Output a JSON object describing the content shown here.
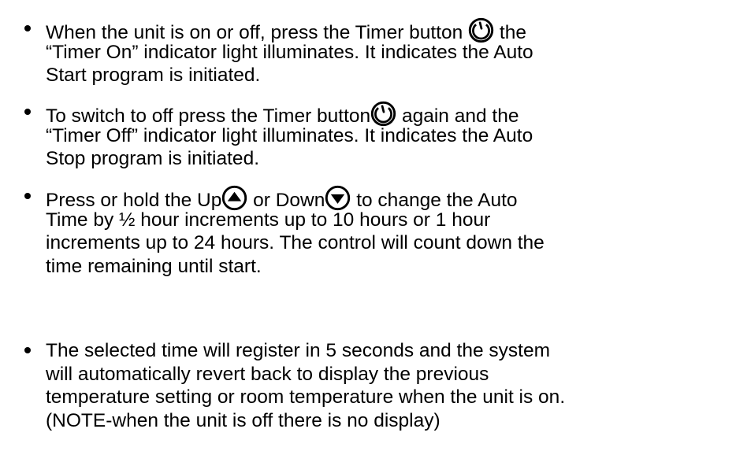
{
  "bullets": [
    {
      "lines": [
        {
          "pre": "When the unit is on or off, press the Timer button ",
          "icon": "timer-icon",
          "post": " the"
        },
        {
          "text": "“Timer On” indicator light illuminates.  It indicates the Auto"
        },
        {
          "text": "Start program is initiated."
        }
      ]
    },
    {
      "lines": [
        {
          "pre": "To switch to off press the Timer button",
          "icon": "timer-icon",
          "post": "  again and the"
        },
        {
          "text": "“Timer Off” indicator light illuminates.  It indicates the Auto"
        },
        {
          "text": "Stop program is initiated."
        }
      ]
    },
    {
      "lines": [
        {
          "pre": "Press or hold the Up",
          "icon1": "up-arrow-icon",
          "mid": " or Down",
          "icon2": "down-arrow-icon",
          "post": " to change the Auto"
        },
        {
          "text": "Time by ½ hour increments up to 10 hours or 1  hour"
        },
        {
          "text": "increments up to 24 hours.  The control will count down the"
        },
        {
          "text": "time remaining until start."
        }
      ]
    },
    {
      "lines": [
        {
          "text": "The selected time will register in 5 seconds and the system"
        },
        {
          "text": "will automatically revert back to display the previous"
        },
        {
          "text": "temperature setting or room temperature when the unit is on."
        },
        {
          "text": "(NOTE-when the unit is off there is no display)"
        }
      ]
    }
  ]
}
